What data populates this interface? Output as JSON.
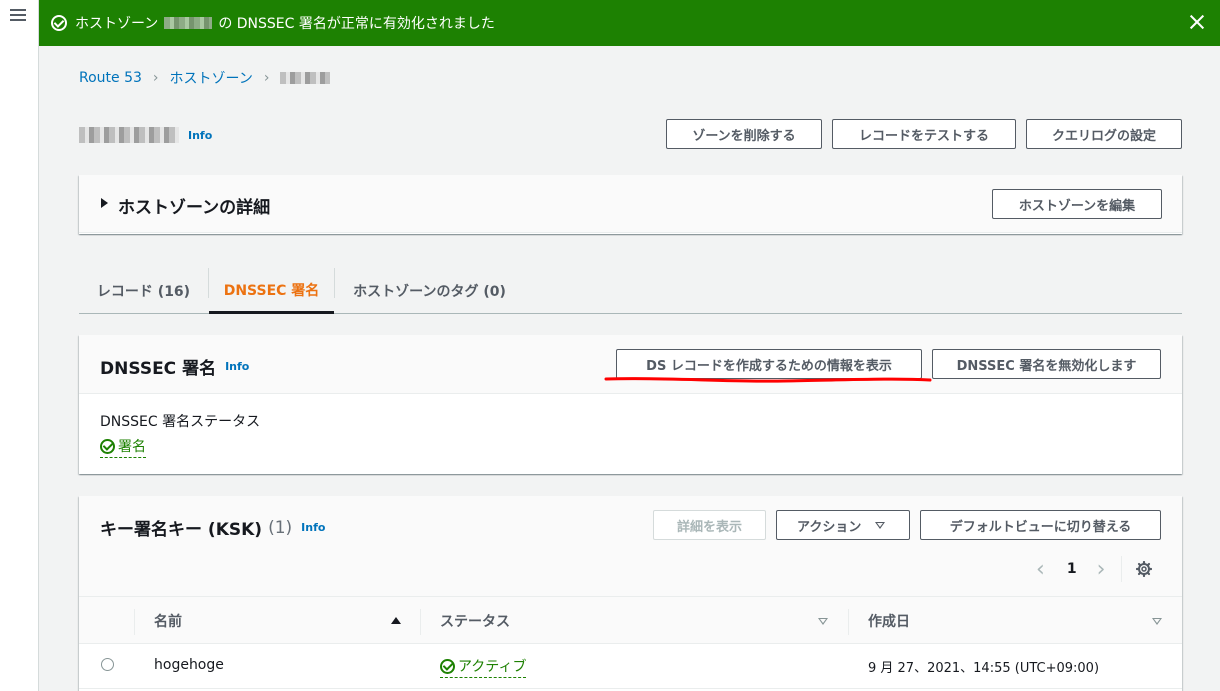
{
  "flash": {
    "message_prefix": "ホストゾーン",
    "message_suffix": "の DNSSEC 署名が正常に有効化されました",
    "color": "#1d8102"
  },
  "breadcrumb": {
    "items": [
      "Route 53",
      "ホストゾーン"
    ]
  },
  "header": {
    "info": "Info",
    "buttons": [
      "ゾーンを削除する",
      "レコードをテストする",
      "クエリログの設定"
    ]
  },
  "details_panel": {
    "title": "ホストゾーンの詳細",
    "edit_button": "ホストゾーンを編集"
  },
  "tabs": [
    {
      "label": "レコード (16)",
      "active": false
    },
    {
      "label": "DNSSEC 署名",
      "active": true
    },
    {
      "label": "ホストゾーンのタグ (0)",
      "active": false
    }
  ],
  "dnssec_panel": {
    "title": "DNSSEC 署名",
    "info": "Info",
    "show_ds_button": "DS レコードを作成するための情報を表示",
    "disable_button": "DNSSEC 署名を無効化します",
    "status_label": "DNSSEC 署名ステータス",
    "status_value": "署名"
  },
  "ksk_panel": {
    "title": "キー署名キー (KSK)",
    "count": "(1)",
    "info": "Info",
    "details_button": "詳細を表示",
    "actions_button": "アクション",
    "default_view_button": "デフォルトビューに切り替える",
    "page_number": "1",
    "columns": [
      "名前",
      "ステータス",
      "作成日"
    ],
    "rows": [
      {
        "name": "hogehoge",
        "status": "アクティブ",
        "created": "9 月 27、2021、14:55 (UTC+09:00)"
      }
    ]
  },
  "colors": {
    "link": "#0073bb",
    "active_tab": "#ec7211",
    "success": "#1d8102",
    "annotation": "#ff0000"
  }
}
